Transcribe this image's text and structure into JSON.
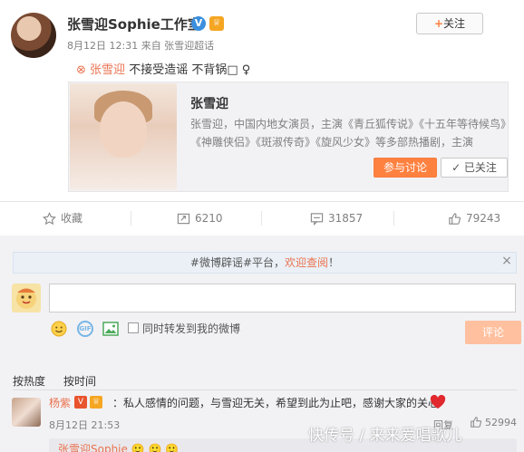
{
  "post": {
    "author": "张雪迎Sophie工作室",
    "verified_badge": "V",
    "member_badge": "♕",
    "follow_button": "关注",
    "follow_plus": "+",
    "meta": "8月12日 12:31 来自 张雪迎超话",
    "text": {
      "topic_icon": "⊗",
      "topic": "张雪迎",
      "body": " 不接受造谣 不背锅□ ♀"
    },
    "card": {
      "title": "张雪迎",
      "description": "张雪迎，中国内地女演员，主演《青丘狐传说》《十五年等待候鸟》《神雕侠侣》《斑淑传奇》《旋风少女》等多部热播剧，主演",
      "join_button": "参与讨论",
      "following_button": "✓ 已关注"
    }
  },
  "actions": {
    "favorite": "收藏",
    "repost": "6210",
    "comment": "31857",
    "like": "79243"
  },
  "comments_area": {
    "notice_prefix": "#微博辟谣#平台，",
    "notice_link": "欢迎查阅",
    "notice_suffix": "！",
    "close": "×",
    "input_placeholder": "",
    "gif_label": "GIF",
    "checkbox_label": "同时转发到我的微博",
    "submit_button": "评论",
    "sort_hot": "按热度",
    "sort_time": "按时间"
  },
  "comment": {
    "name": "杨紫",
    "badge_v": "V",
    "badge_crown": "♕",
    "text": "：私人感情的问题，与雪迎无关，希望到此为止吧，感谢大家的关心",
    "time": "8月12日 21:53",
    "reply": "回复",
    "likes": "52994"
  },
  "reply_preview": {
    "name": "张雪迎Sophie",
    "emojis": "🙂 🙂 🙂"
  },
  "watermark": "快传号 / 来来爱唱歌儿",
  "colors": {
    "accent": "#eb7350",
    "button_orange": "#ff8140",
    "verified_blue": "#3b8fdd",
    "heart": "#e0282e"
  }
}
